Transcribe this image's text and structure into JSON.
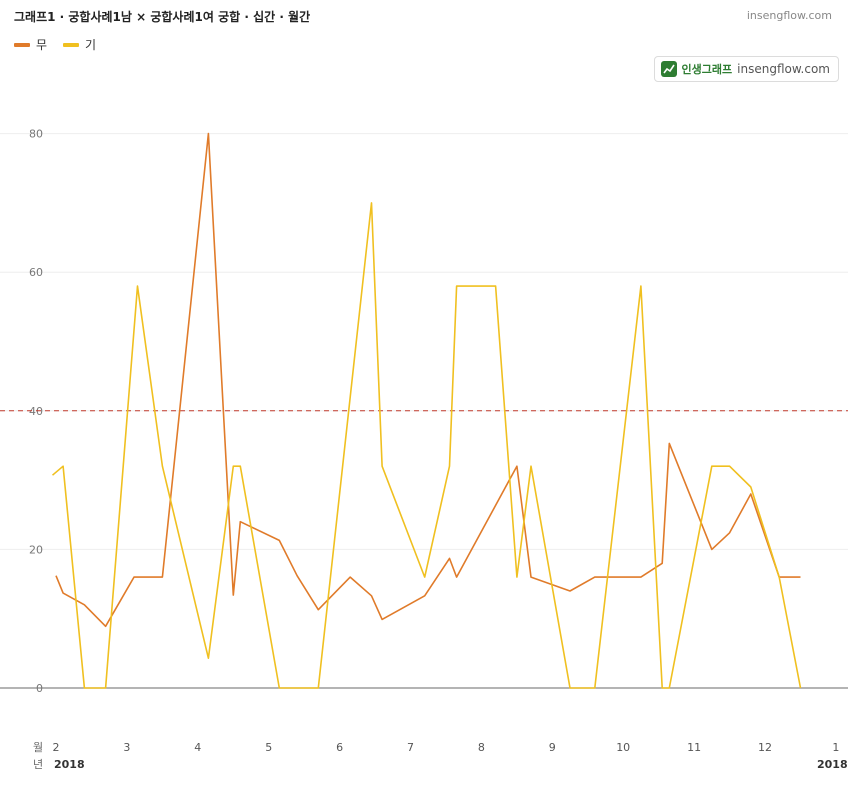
{
  "header": {
    "title": "그래프1 · 궁합사례1남 × 궁합사례1여 궁합 · 십간 · 월간",
    "site": "insengflow.com"
  },
  "badge": {
    "name": "인생그래프",
    "url": "insengflow.com",
    "color": "#2e7d32"
  },
  "legend": [
    {
      "label": "무",
      "color": "#e07b2a"
    },
    {
      "label": "기",
      "color": "#f0c020"
    }
  ],
  "axis": {
    "month_row_label": "월",
    "year_row_label": "년",
    "year_labels": [
      "2018",
      "2018"
    ]
  },
  "chart_data": {
    "type": "line",
    "title": "그래프1 · 궁합사례1남 × 궁합사례1여 궁합 · 십간 · 월간",
    "x_axis": "month",
    "x_ticks": [
      "2",
      "3",
      "4",
      "5",
      "6",
      "7",
      "8",
      "9",
      "10",
      "11",
      "12",
      "1"
    ],
    "y_ticks": [
      0,
      20,
      40,
      60,
      80
    ],
    "ylim": [
      -8,
      85
    ],
    "reference_line": {
      "y": 40,
      "style": "dashed",
      "color": "#c0392b"
    },
    "grid": true,
    "legend_position": "top-left",
    "series": [
      {
        "name": "무",
        "color": "#e07b2a",
        "points": [
          [
            2.0,
            16.2
          ],
          [
            2.1,
            13.7
          ],
          [
            2.4,
            12.0
          ],
          [
            2.7,
            8.9
          ],
          [
            3.1,
            16.0
          ],
          [
            3.5,
            16.0
          ],
          [
            4.15,
            80.0
          ],
          [
            4.5,
            13.4
          ],
          [
            4.6,
            24.0
          ],
          [
            5.15,
            21.3
          ],
          [
            5.4,
            16.2
          ],
          [
            5.7,
            11.3
          ],
          [
            6.15,
            16.0
          ],
          [
            6.45,
            13.3
          ],
          [
            6.6,
            9.9
          ],
          [
            7.2,
            13.3
          ],
          [
            7.55,
            18.7
          ],
          [
            7.65,
            16.0
          ],
          [
            8.5,
            32.0
          ],
          [
            8.7,
            16.0
          ],
          [
            9.25,
            14.0
          ],
          [
            9.6,
            16.0
          ],
          [
            10.25,
            16.0
          ],
          [
            10.55,
            18.0
          ],
          [
            10.65,
            35.3
          ],
          [
            11.25,
            20.0
          ],
          [
            11.5,
            22.4
          ],
          [
            11.8,
            28.0
          ],
          [
            12.2,
            16.0
          ],
          [
            12.5,
            16.0
          ]
        ]
      },
      {
        "name": "기",
        "color": "#f0c020",
        "points": [
          [
            1.95,
            30.7
          ],
          [
            2.1,
            32.0
          ],
          [
            2.4,
            0.0
          ],
          [
            2.7,
            0.0
          ],
          [
            3.15,
            58.0
          ],
          [
            3.5,
            32.0
          ],
          [
            4.15,
            4.3
          ],
          [
            4.5,
            32.0
          ],
          [
            4.6,
            32.0
          ],
          [
            5.15,
            0.0
          ],
          [
            5.7,
            0.0
          ],
          [
            6.45,
            70.0
          ],
          [
            6.6,
            32.0
          ],
          [
            7.2,
            16.0
          ],
          [
            7.55,
            32.0
          ],
          [
            7.65,
            58.0
          ],
          [
            8.2,
            58.0
          ],
          [
            8.5,
            16.0
          ],
          [
            8.7,
            32.0
          ],
          [
            9.25,
            0.0
          ],
          [
            9.6,
            0.0
          ],
          [
            10.25,
            58.0
          ],
          [
            10.55,
            0.0
          ],
          [
            10.65,
            0.0
          ],
          [
            11.25,
            32.0
          ],
          [
            11.5,
            32.0
          ],
          [
            11.8,
            29.0
          ],
          [
            12.2,
            16.0
          ],
          [
            12.5,
            0.0
          ]
        ]
      }
    ]
  }
}
